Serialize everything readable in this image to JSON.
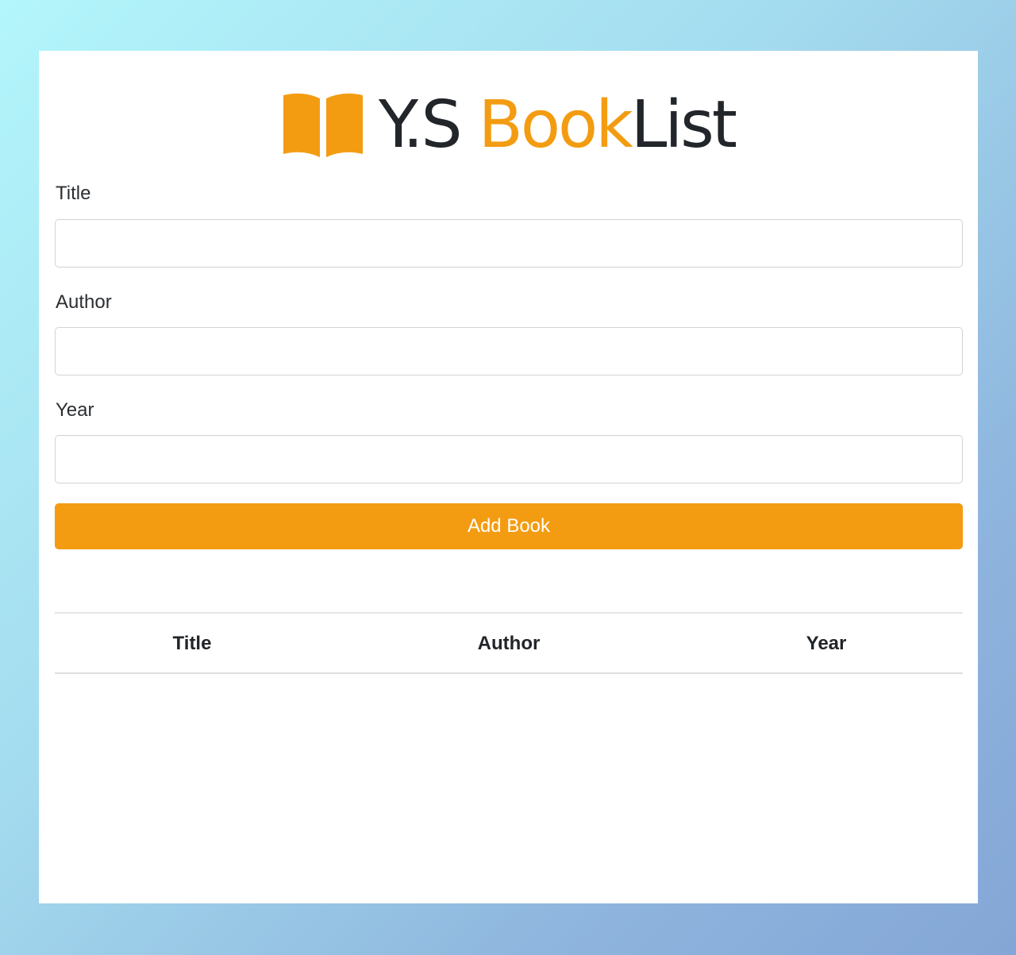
{
  "header": {
    "brand_prefix": "Y.S ",
    "brand_accent": "Book",
    "brand_suffix": "List",
    "icon": "open-book-icon"
  },
  "form": {
    "title_label": "Title",
    "title_value": "",
    "author_label": "Author",
    "author_value": "",
    "year_label": "Year",
    "year_value": "",
    "submit_label": "Add Book"
  },
  "table": {
    "columns": [
      "Title",
      "Author",
      "Year"
    ],
    "rows": []
  },
  "colors": {
    "accent": "#f39c12",
    "text": "#22262b"
  }
}
